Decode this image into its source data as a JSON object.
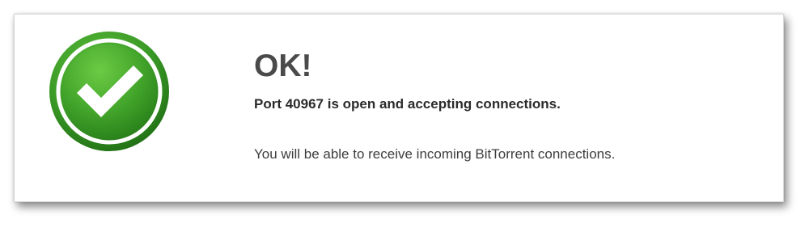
{
  "result": {
    "title": "OK!",
    "port_message": "Port 40967 is open and accepting connections.",
    "detail_message": "You will be able to receive incoming BitTorrent connections."
  },
  "icon": {
    "name": "checkmark-success-icon",
    "color_outer": "#2f8a1f",
    "color_inner": "#4cab2f",
    "color_ring": "#ffffff"
  }
}
